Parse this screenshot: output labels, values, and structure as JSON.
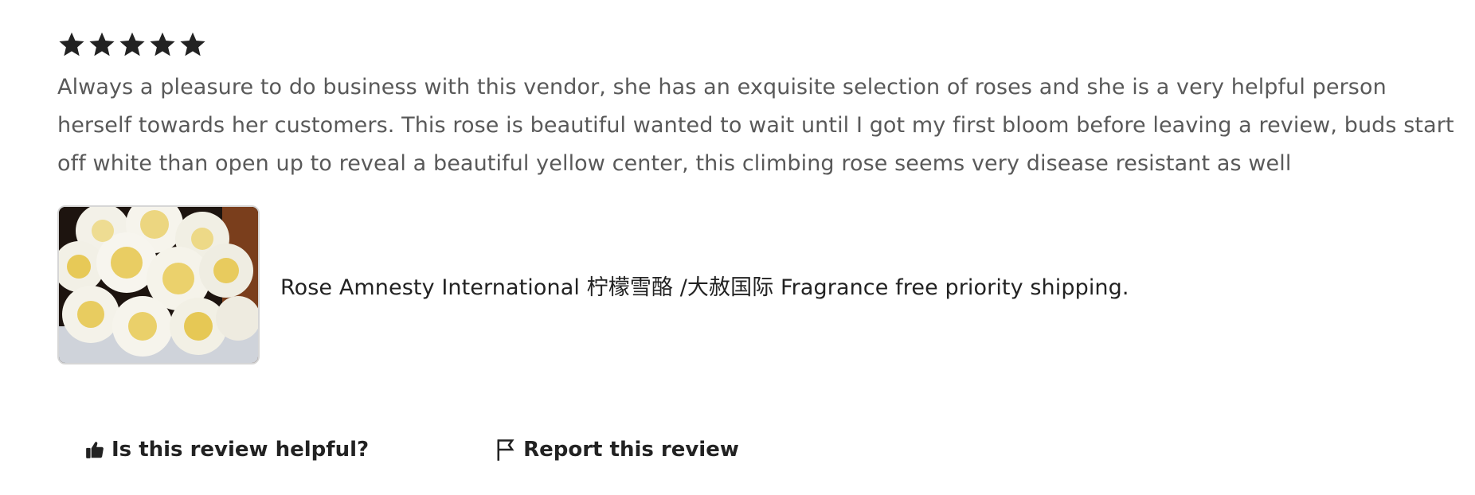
{
  "review": {
    "rating": 5,
    "rating_max": 5,
    "star_icon": "star-icon",
    "text": "Always a pleasure to do business with this vendor, she has an exquisite selection of roses and she is a very helpful person herself towards her customers. This rose is beautiful wanted to wait until I got my first bloom before leaving a review, buds start off white than open up to reveal a beautiful yellow center, this climbing rose seems very disease resistant as well"
  },
  "listing": {
    "title": "Rose Amnesty International 柠檬雪酪 /大赦国际 Fragrance free priority shipping.",
    "image_icon": "rose-bouquet-image"
  },
  "actions": {
    "helpful_label": "Is this review helpful?",
    "helpful_icon": "thumbs-up-icon",
    "report_label": "Report this review",
    "report_icon": "flag-icon"
  },
  "colors": {
    "text_primary": "#222222",
    "text_review": "#595959",
    "star": "#222222"
  }
}
